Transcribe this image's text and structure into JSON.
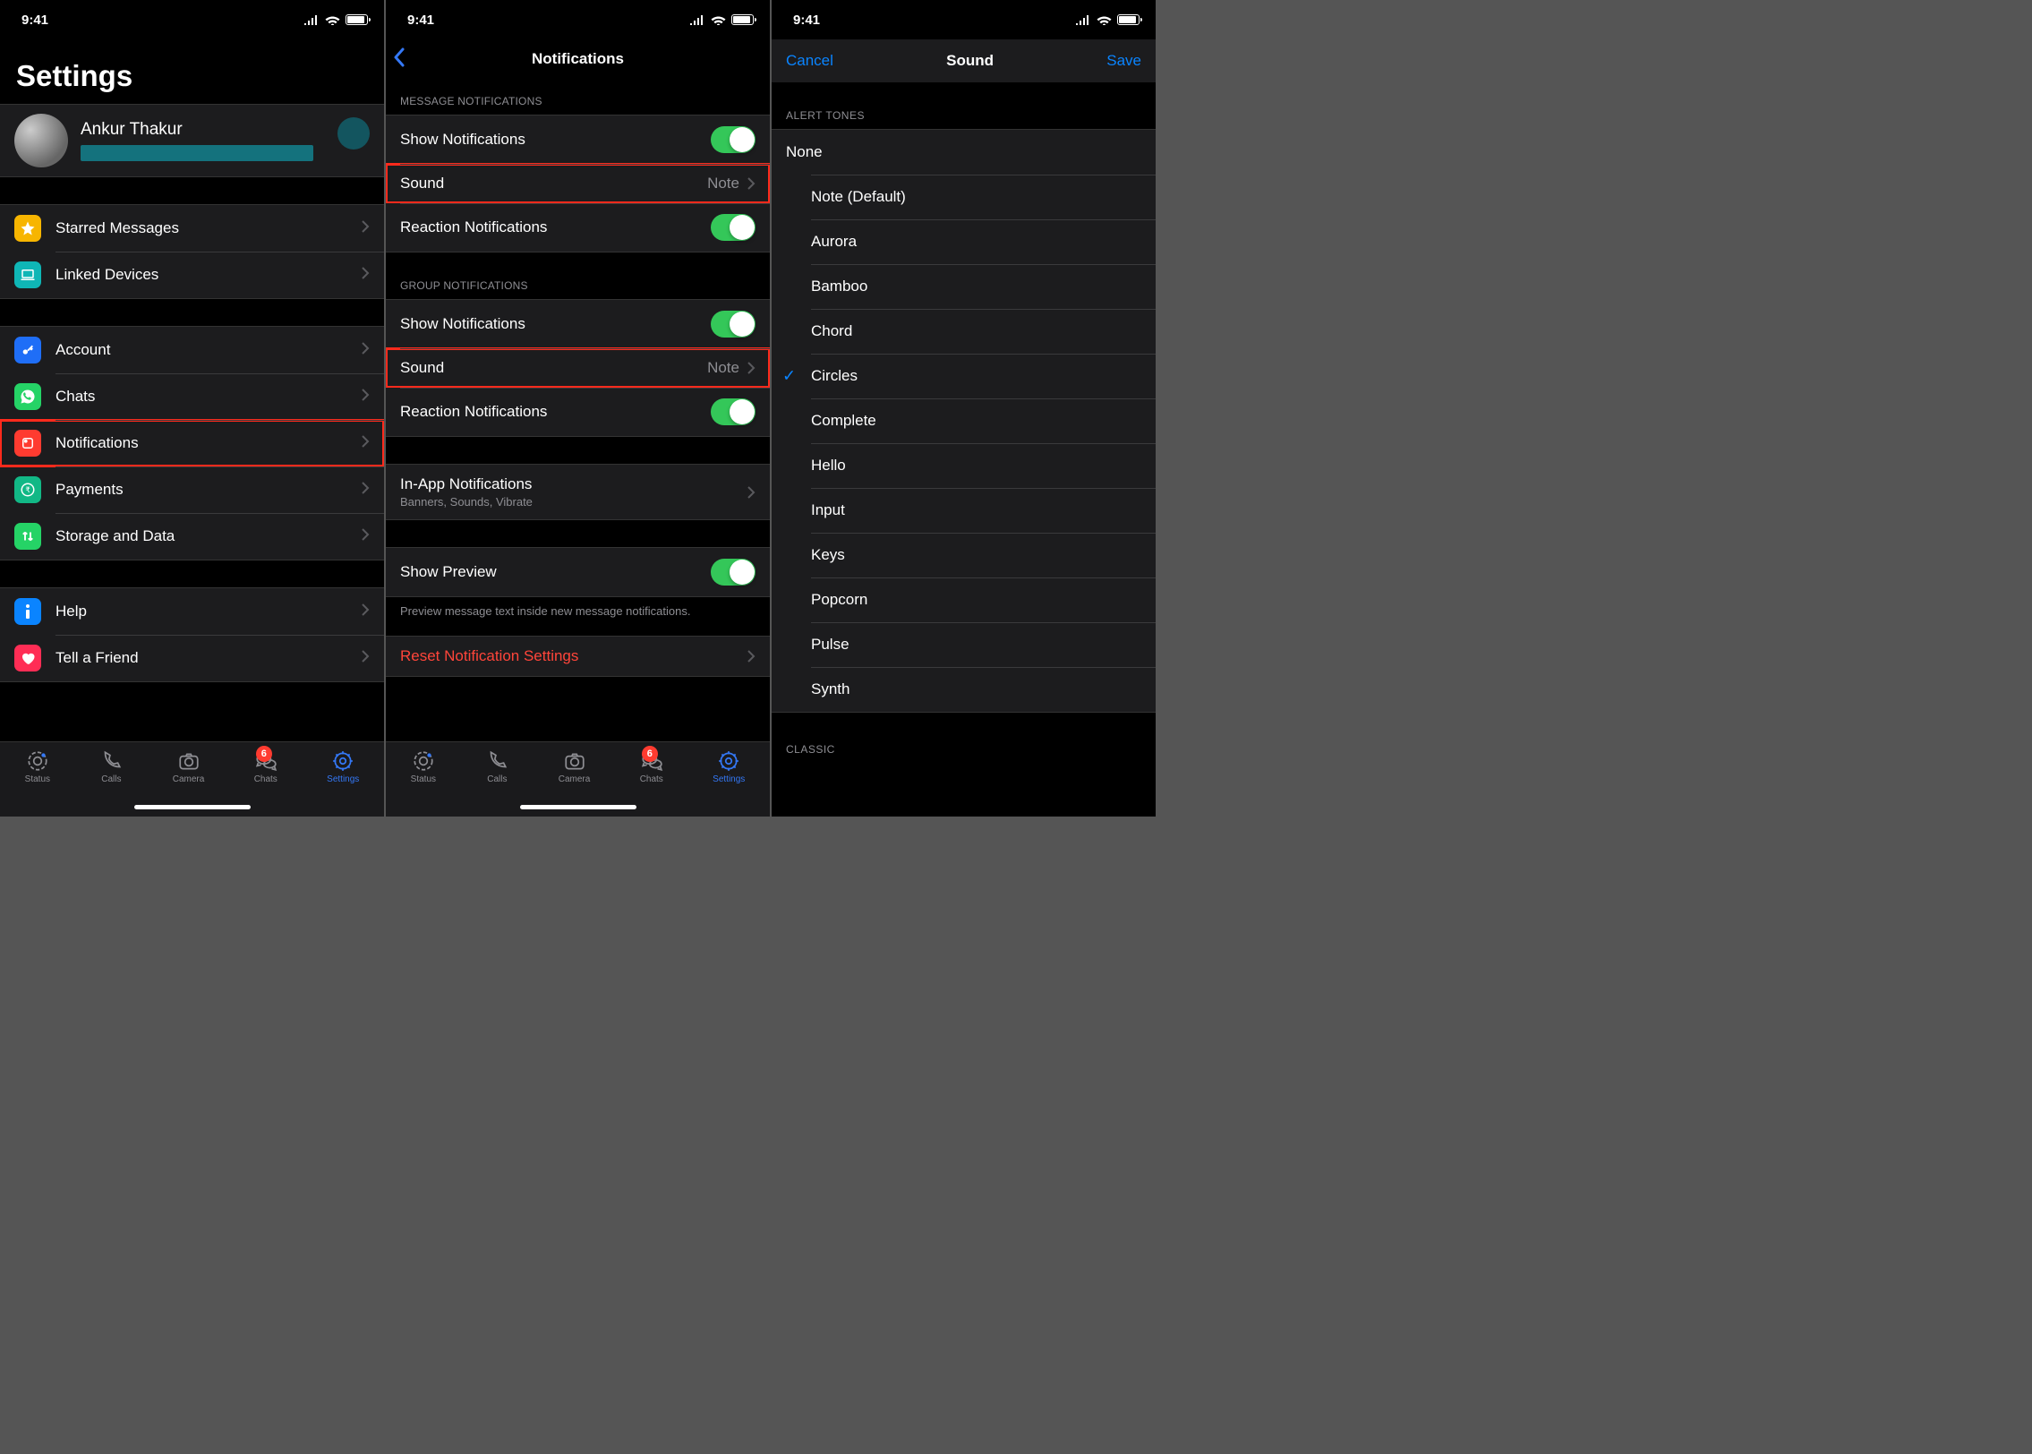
{
  "statusbar": {
    "time": "9:41"
  },
  "screen1": {
    "title": "Settings",
    "profile": {
      "name": "Ankur Thakur"
    },
    "section1": [
      {
        "label": "Starred Messages",
        "icon": "star",
        "color": "c-yellow"
      },
      {
        "label": "Linked Devices",
        "icon": "laptop",
        "color": "c-teal"
      }
    ],
    "section2": [
      {
        "label": "Account",
        "icon": "key",
        "color": "c-blue"
      },
      {
        "label": "Chats",
        "icon": "whatsapp",
        "color": "c-green"
      },
      {
        "label": "Notifications",
        "icon": "bell",
        "color": "c-red",
        "highlight": true
      },
      {
        "label": "Payments",
        "icon": "rupee",
        "color": "c-mint"
      },
      {
        "label": "Storage and Data",
        "icon": "updown",
        "color": "c-green"
      }
    ],
    "section3": [
      {
        "label": "Help",
        "icon": "info",
        "color": "c-info"
      },
      {
        "label": "Tell a Friend",
        "icon": "heart",
        "color": "c-pink"
      }
    ]
  },
  "screen2": {
    "title": "Notifications",
    "headers": {
      "msg": "MESSAGE NOTIFICATIONS",
      "group": "GROUP NOTIFICATIONS"
    },
    "rows": {
      "showNotifs": "Show Notifications",
      "sound": "Sound",
      "soundValue": "Note",
      "reaction": "Reaction Notifications",
      "inapp": "In-App Notifications",
      "inappSub": "Banners, Sounds, Vibrate",
      "preview": "Show Preview",
      "previewFooter": "Preview message text inside new message notifications.",
      "reset": "Reset Notification Settings"
    }
  },
  "screen3": {
    "cancel": "Cancel",
    "title": "Sound",
    "save": "Save",
    "header1": "ALERT TONES",
    "header2": "CLASSIC",
    "selected": "Circles",
    "tones": [
      "None",
      "Note (Default)",
      "Aurora",
      "Bamboo",
      "Chord",
      "Circles",
      "Complete",
      "Hello",
      "Input",
      "Keys",
      "Popcorn",
      "Pulse",
      "Synth"
    ]
  },
  "tabbar": {
    "status": "Status",
    "calls": "Calls",
    "camera": "Camera",
    "chats": "Chats",
    "settings": "Settings",
    "badge": "6"
  }
}
